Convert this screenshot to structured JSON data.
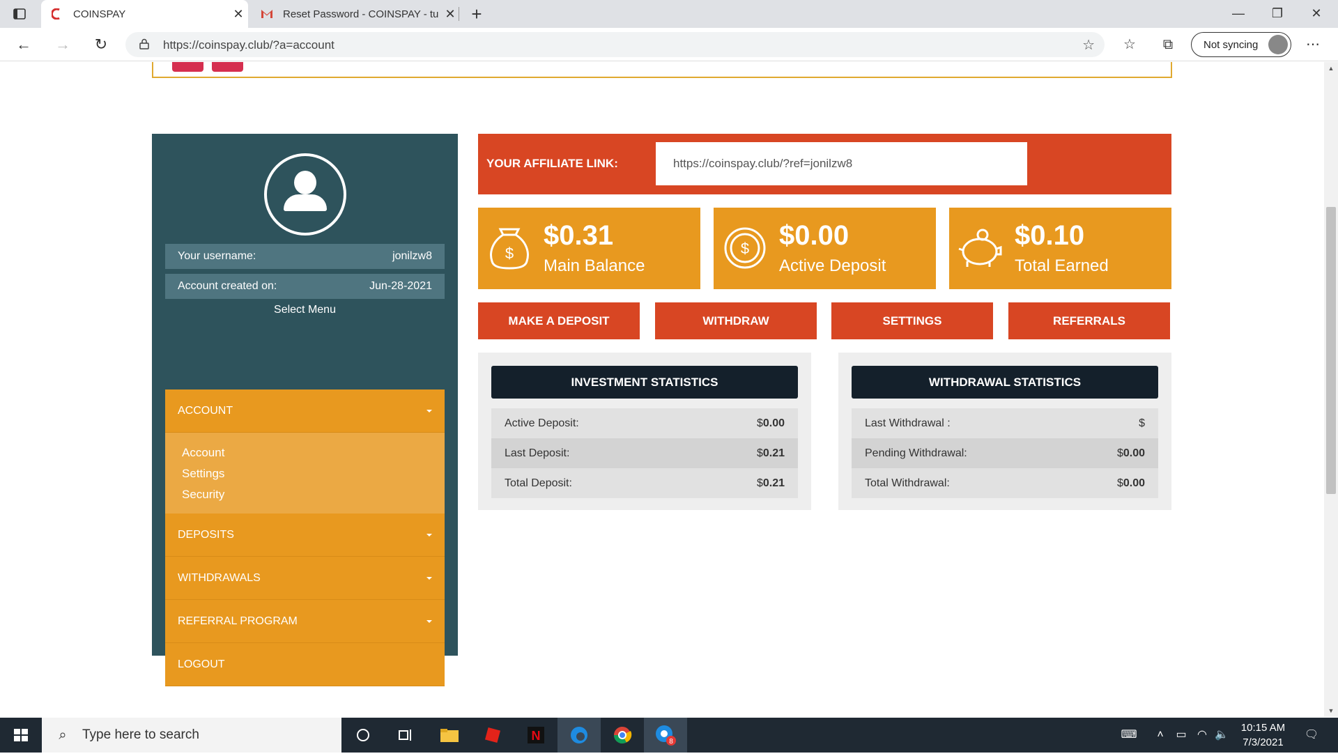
{
  "browser": {
    "tabs": [
      {
        "title": "COINSPAY",
        "active": true
      },
      {
        "title": "Reset Password - COINSPAY - tu",
        "active": false
      }
    ],
    "url": "https://coinspay.club/?a=account",
    "sync_label": "Not syncing"
  },
  "sidebar": {
    "username_label": "Your username:",
    "username": "jonilzw8",
    "created_label": "Account created on:",
    "created": "Jun-28-2021",
    "select_menu": "Select Menu",
    "menu": [
      {
        "label": "ACCOUNT"
      },
      {
        "label": "DEPOSITS"
      },
      {
        "label": "WITHDRAWALS"
      },
      {
        "label": "REFERRAL PROGRAM"
      },
      {
        "label": "LOGOUT"
      }
    ],
    "submenu": [
      "Account",
      "Settings",
      "Security"
    ]
  },
  "affiliate": {
    "label": "YOUR AFFILIATE LINK:",
    "link": "https://coinspay.club/?ref=jonilzw8"
  },
  "cards": [
    {
      "amount": "$0.31",
      "caption": "Main Balance",
      "icon": "money-bag-icon"
    },
    {
      "amount": "$0.00",
      "caption": "Active Deposit",
      "icon": "coin-icon"
    },
    {
      "amount": "$0.10",
      "caption": "Total Earned",
      "icon": "piggy-bank-icon"
    }
  ],
  "actions": [
    "MAKE A DEPOSIT",
    "WITHDRAW",
    "SETTINGS",
    "REFERRALS"
  ],
  "investment": {
    "title": "INVESTMENT STATISTICS",
    "rows": [
      {
        "label": "Active Deposit:",
        "cur": "$",
        "value": "0.00"
      },
      {
        "label": "Last Deposit:",
        "cur": "$",
        "value": "0.21"
      },
      {
        "label": "Total Deposit:",
        "cur": "$",
        "value": "0.21"
      }
    ]
  },
  "withdrawal": {
    "title": "WITHDRAWAL STATISTICS",
    "rows": [
      {
        "label": "Last Withdrawal :",
        "cur": "$",
        "value": ""
      },
      {
        "label": "Pending Withdrawal:",
        "cur": "$",
        "value": "0.00"
      },
      {
        "label": "Total Withdrawal:",
        "cur": "$",
        "value": "0.00"
      }
    ]
  },
  "taskbar": {
    "search_placeholder": "Type here to search",
    "time": "10:15 AM",
    "date": "7/3/2021",
    "chrome_badge": "8"
  },
  "colors": {
    "sidebar": "#2e535c",
    "orange": "#e8991f",
    "red": "#d84623",
    "dark_header": "#14202b"
  }
}
